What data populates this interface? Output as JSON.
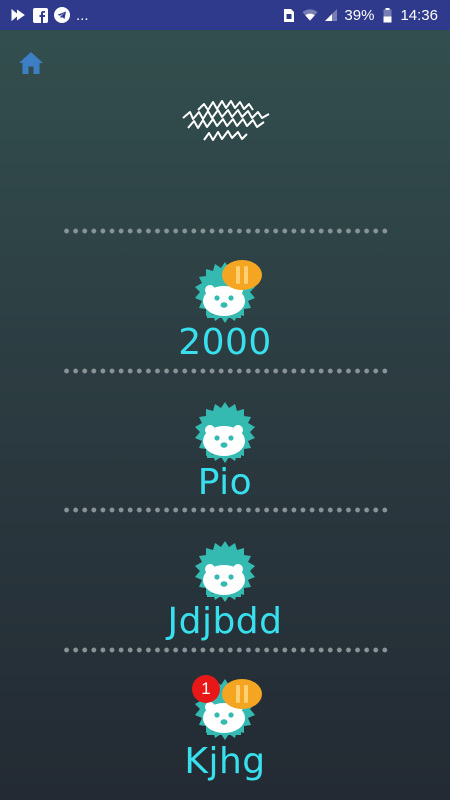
{
  "status_bar": {
    "battery": "39%",
    "time": "14:36",
    "more": "...",
    "icons": [
      "notification-icon",
      "facebook-icon",
      "telegram-icon",
      "sim-icon",
      "wifi-icon",
      "battery-icon"
    ]
  },
  "nav": {
    "home_icon": "home-icon"
  },
  "colors": {
    "accent": "#38e0ee",
    "hedgehog": "#35bab2",
    "coin": "#f4a623",
    "badge": "#e81818",
    "status_bar": "#2f3a8c"
  },
  "players": [
    {
      "name": "2000",
      "has_coin": true,
      "badge": ""
    },
    {
      "name": "Pio",
      "has_coin": false,
      "badge": ""
    },
    {
      "name": "Jdjbdd",
      "has_coin": false,
      "badge": ""
    },
    {
      "name": "Kjhg",
      "has_coin": true,
      "badge": "1"
    }
  ]
}
